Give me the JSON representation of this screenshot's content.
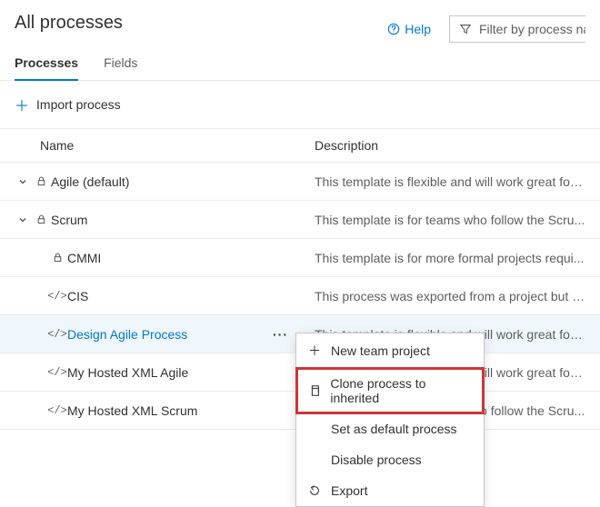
{
  "header": {
    "title": "All processes"
  },
  "help": {
    "label": "Help"
  },
  "filter": {
    "placeholder": "Filter by process name"
  },
  "tabs": {
    "processes": "Processes",
    "fields": "Fields",
    "active": "processes"
  },
  "toolbar": {
    "import": "Import process"
  },
  "columns": {
    "name": "Name",
    "description": "Description"
  },
  "rows": [
    {
      "name": "Agile (default)",
      "desc": "This template is flexible and will work great for ...",
      "icon": "lock",
      "expandable": true,
      "indent": 0
    },
    {
      "name": "Scrum",
      "desc": "This template is for teams who follow the Scru...",
      "icon": "lock",
      "expandable": true,
      "indent": 0
    },
    {
      "name": "CMMI",
      "desc": "This template is for more formal projects requi...",
      "icon": "lock",
      "expandable": false,
      "indent": 1
    },
    {
      "name": "CIS",
      "desc": "This process was exported from a project but n...",
      "icon": "code",
      "expandable": false,
      "indent": 1
    },
    {
      "name": "Design Agile Process",
      "desc": "This template is flexible and will work great for ...",
      "icon": "code",
      "expandable": false,
      "indent": 1,
      "selected": true,
      "link": true
    },
    {
      "name": "My Hosted XML Agile",
      "desc": "This template is flexible and will work great for ...",
      "icon": "code",
      "expandable": false,
      "indent": 1
    },
    {
      "name": "My Hosted XML Scrum",
      "desc": "This template is for teams who follow the Scru...",
      "icon": "code",
      "expandable": false,
      "indent": 1
    }
  ],
  "context_menu": {
    "new_team_project": "New team project",
    "clone_to_inherited": "Clone process to inherited",
    "set_default": "Set as default process",
    "disable": "Disable process",
    "export": "Export"
  }
}
